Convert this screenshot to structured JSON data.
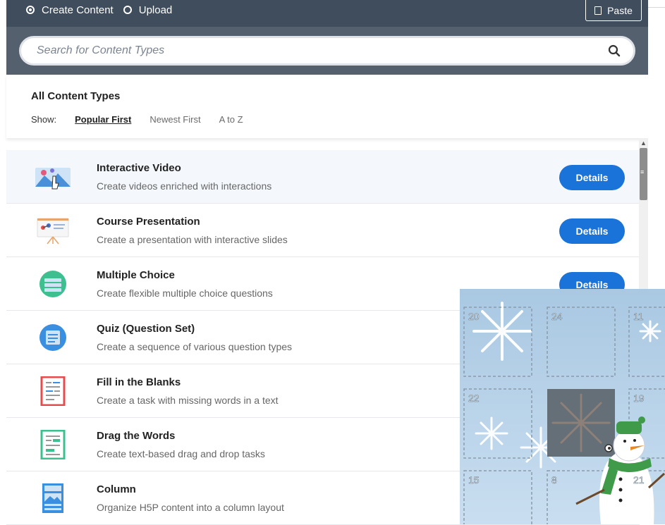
{
  "tabs": {
    "create": "Create Content",
    "upload": "Upload"
  },
  "paste_label": "Paste",
  "search": {
    "placeholder": "Search for Content Types"
  },
  "header": {
    "title": "All Content Types",
    "show_label": "Show:",
    "sort_options": [
      "Popular First",
      "Newest First",
      "A to Z"
    ],
    "selected": "Popular First"
  },
  "details_label": "Details",
  "items": [
    {
      "title": "Interactive Video",
      "desc": "Create videos enriched with interactions",
      "icon": "interactive-video-icon"
    },
    {
      "title": "Course Presentation",
      "desc": "Create a presentation with interactive slides",
      "icon": "course-presentation-icon"
    },
    {
      "title": "Multiple Choice",
      "desc": "Create flexible multiple choice questions",
      "icon": "multiple-choice-icon"
    },
    {
      "title": "Quiz (Question Set)",
      "desc": "Create a sequence of various question types",
      "icon": "quiz-icon"
    },
    {
      "title": "Fill in the Blanks",
      "desc": "Create a task with missing words in a text",
      "icon": "fill-blanks-icon"
    },
    {
      "title": "Drag the Words",
      "desc": "Create text-based drag and drop tasks",
      "icon": "drag-words-icon"
    },
    {
      "title": "Column",
      "desc": "Organize H5P content into a column layout",
      "icon": "column-icon"
    }
  ],
  "calendar": {
    "doors": [
      "20",
      "24",
      "11",
      "22",
      "19",
      "15",
      "8",
      "21"
    ]
  },
  "colors": {
    "topbar": "#404d5c",
    "search_band": "#55606e",
    "button": "#1a73d9",
    "calendar_bg": "#b9d4ea"
  }
}
